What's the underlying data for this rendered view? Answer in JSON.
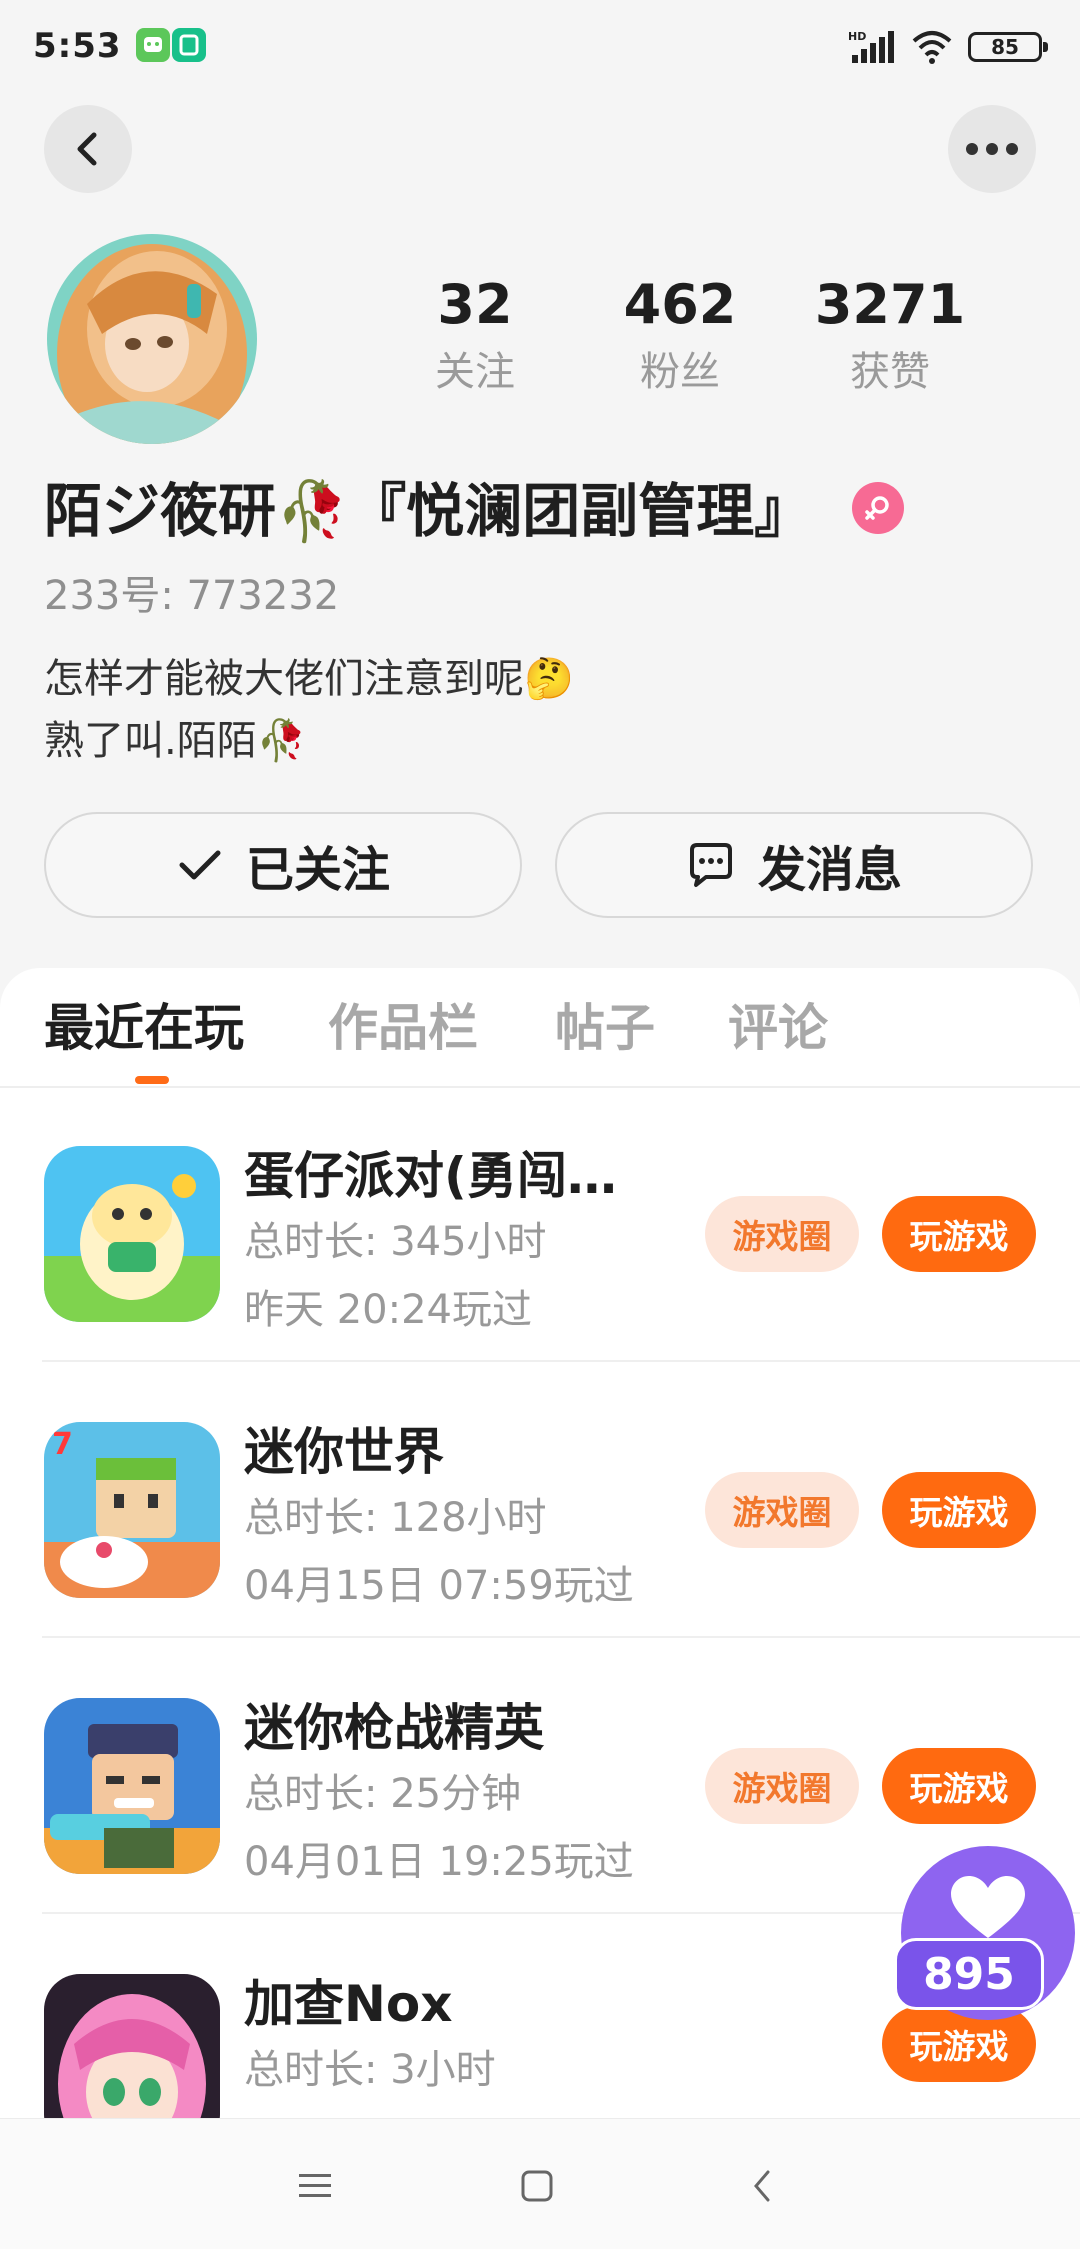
{
  "status_bar": {
    "time": "5:53",
    "battery": "85",
    "network": "HD"
  },
  "profile": {
    "stats": [
      {
        "value": "32",
        "label": "关注"
      },
      {
        "value": "462",
        "label": "粉丝"
      },
      {
        "value": "3271",
        "label": "获赞"
      }
    ],
    "name": "陌ジ筱研🥀『悦澜团副管理』",
    "id_line": "233号: 773232",
    "bio_line1": "怎样才能被大佬们注意到呢🤔",
    "bio_line2": "熟了叫.陌陌🥀",
    "follow_label": "已关注",
    "message_label": "发消息"
  },
  "tabs": [
    "最近在玩",
    "作品栏",
    "帖子",
    "评论"
  ],
  "games": [
    {
      "title": "蛋仔派对(勇闯…",
      "duration": "总时长: 345小时",
      "last_played": "昨天 20:24玩过",
      "circle_label": "游戏圈",
      "play_label": "玩游戏"
    },
    {
      "title": "迷你世界",
      "duration": "总时长: 128小时",
      "last_played": "04月15日 07:59玩过",
      "circle_label": "游戏圈",
      "play_label": "玩游戏"
    },
    {
      "title": "迷你枪战精英",
      "duration": "总时长: 25分钟",
      "last_played": "04月01日 19:25玩过",
      "circle_label": "游戏圈",
      "play_label": "玩游戏"
    },
    {
      "title": "加查Nox",
      "duration": "总时长: 3小时",
      "last_played": "",
      "circle_label": "",
      "play_label": "玩游戏"
    }
  ],
  "like_bubble": {
    "count": "895"
  },
  "colors": {
    "accent": "#ff6a10",
    "pill_bg": "#fde5d9",
    "like": "#8e64f0",
    "gender": "#f76a94"
  },
  "icons": [
    "back-arrow-icon",
    "more-dots-icon",
    "checkmark-icon",
    "chat-bubble-icon",
    "heart-icon",
    "female-gender-icon",
    "menu-icon",
    "home-square-icon",
    "back-chevron-icon"
  ]
}
